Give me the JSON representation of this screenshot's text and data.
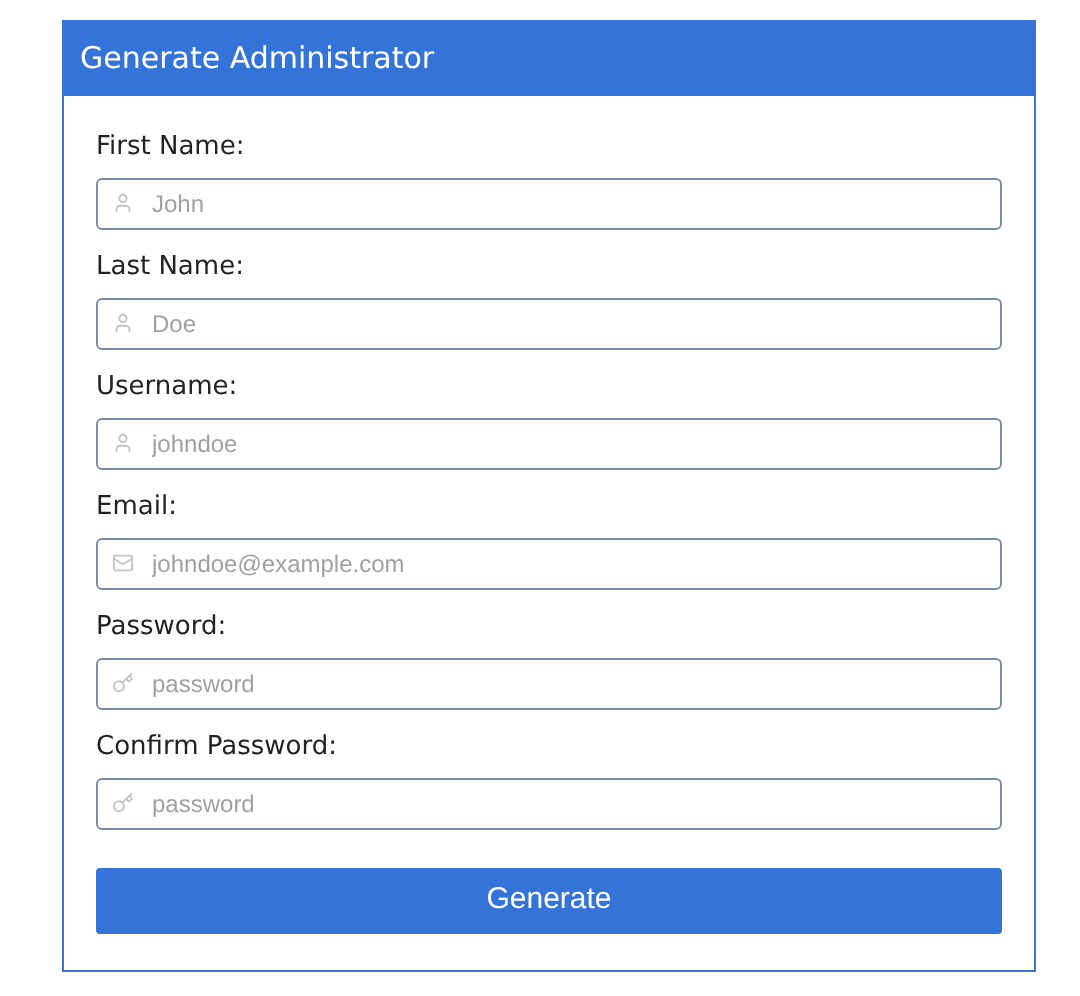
{
  "panel": {
    "title": "Generate Administrator"
  },
  "fields": [
    {
      "label": "First Name:",
      "placeholder": "John",
      "kind": "user"
    },
    {
      "label": "Last Name:",
      "placeholder": "Doe",
      "kind": "user"
    },
    {
      "label": "Username:",
      "placeholder": "johndoe",
      "kind": "user"
    },
    {
      "label": "Email:",
      "placeholder": "johndoe@example.com",
      "kind": "mail"
    },
    {
      "label": "Password:",
      "placeholder": "password",
      "kind": "key"
    },
    {
      "label": "Confirm Password:",
      "placeholder": "password",
      "kind": "key"
    }
  ],
  "submit": "Generate"
}
